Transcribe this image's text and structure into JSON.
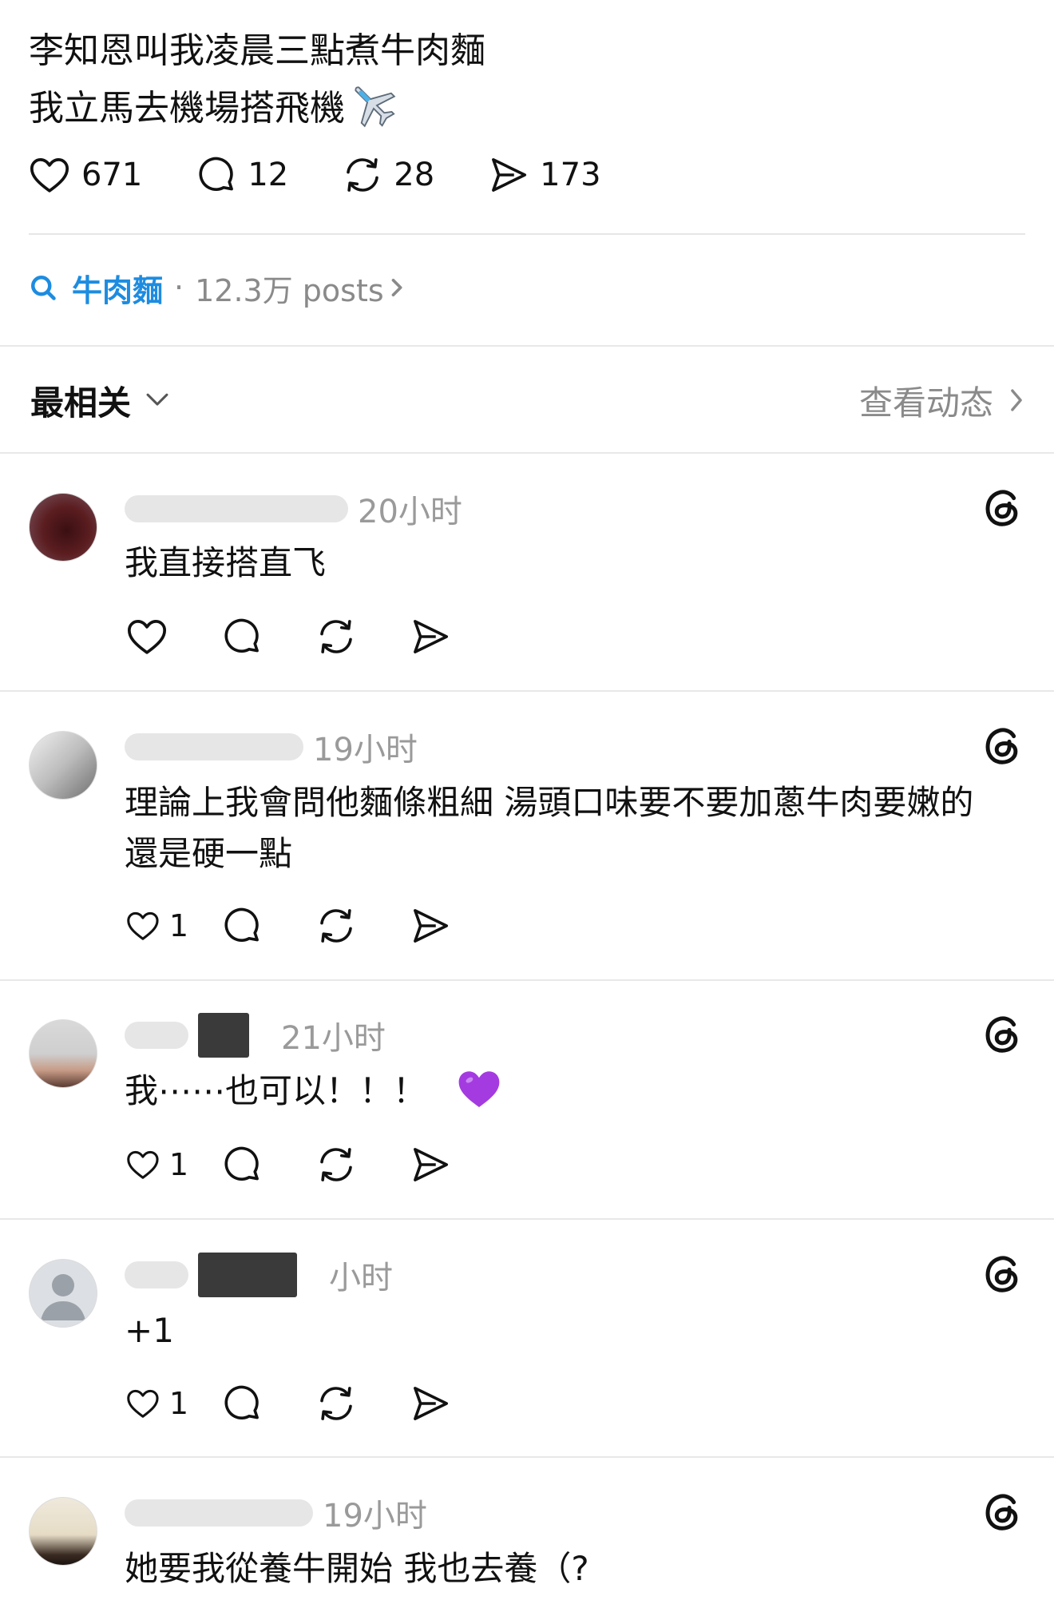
{
  "post": {
    "line1": "李知恩叫我凌晨三點煮牛肉麵",
    "line2": "我立馬去機場搭飛機",
    "emoji_name": "airplane-emoji",
    "likes": "671",
    "comments": "12",
    "reposts": "28",
    "shares": "173"
  },
  "topic": {
    "tag": "牛肉麵",
    "separator": "·",
    "count": "12.3万 posts"
  },
  "sort": {
    "label": "最相关",
    "activity_label": "查看动态"
  },
  "replies": [
    {
      "time": "20小时",
      "text": "我直接搭直飞",
      "likes": ""
    },
    {
      "time": "19小时",
      "text": "理論上我會問他麵條粗細 湯頭口味要不要加蔥牛肉要嫩的還是硬一點",
      "likes": "1"
    },
    {
      "time": "21小时",
      "text": "我⋯⋯也可以！！！",
      "emoji": "purple-heart-emoji",
      "likes": "1"
    },
    {
      "time": "小时",
      "text": "+1",
      "likes": "1"
    },
    {
      "time": "19小时",
      "text": "她要我從養牛開始 我也去養（?",
      "likes": ""
    }
  ],
  "colors": {
    "accent": "#1d8ce0",
    "muted": "#8a8a8a",
    "divider": "#e8e8e8"
  }
}
